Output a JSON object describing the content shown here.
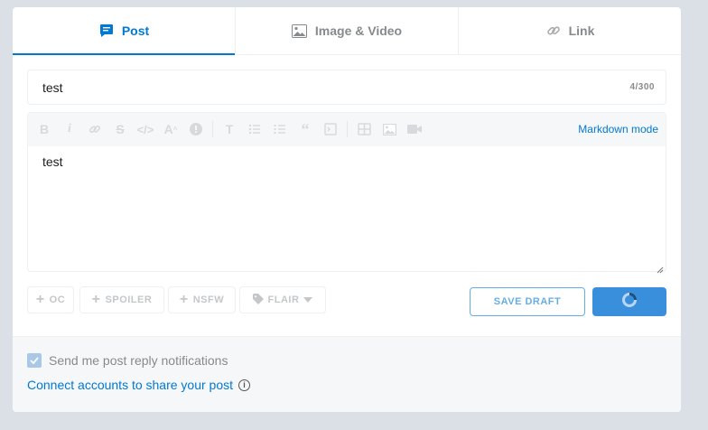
{
  "tabs": [
    {
      "label": "Post",
      "icon": "post-icon",
      "active": true
    },
    {
      "label": "Image & Video",
      "icon": "image-icon",
      "active": false
    },
    {
      "label": "Link",
      "icon": "link-icon",
      "active": false
    }
  ],
  "title_field": {
    "value": "test",
    "counter": "4/300"
  },
  "editor": {
    "toolbar_icons": [
      "bold-icon",
      "italic-icon",
      "link-icon",
      "strikethrough-icon",
      "code-icon",
      "superscript-icon",
      "spoiler-icon",
      "heading-icon",
      "bulleted-list-icon",
      "numbered-list-icon",
      "quote-icon",
      "code-block-icon",
      "table-icon",
      "image-icon",
      "video-icon"
    ],
    "markdown_mode_label": "Markdown mode",
    "body": "test"
  },
  "tags": {
    "oc": "OC",
    "spoiler": "SPOILER",
    "nsfw": "NSFW",
    "flair": "FLAIR"
  },
  "buttons": {
    "save_draft": "SAVE DRAFT"
  },
  "footer": {
    "notify_label": "Send me post reply notifications",
    "notify_checked": true,
    "connect_label": "Connect accounts to share your post"
  },
  "colors": {
    "accent": "#0079d3",
    "background": "#dae0e6"
  }
}
